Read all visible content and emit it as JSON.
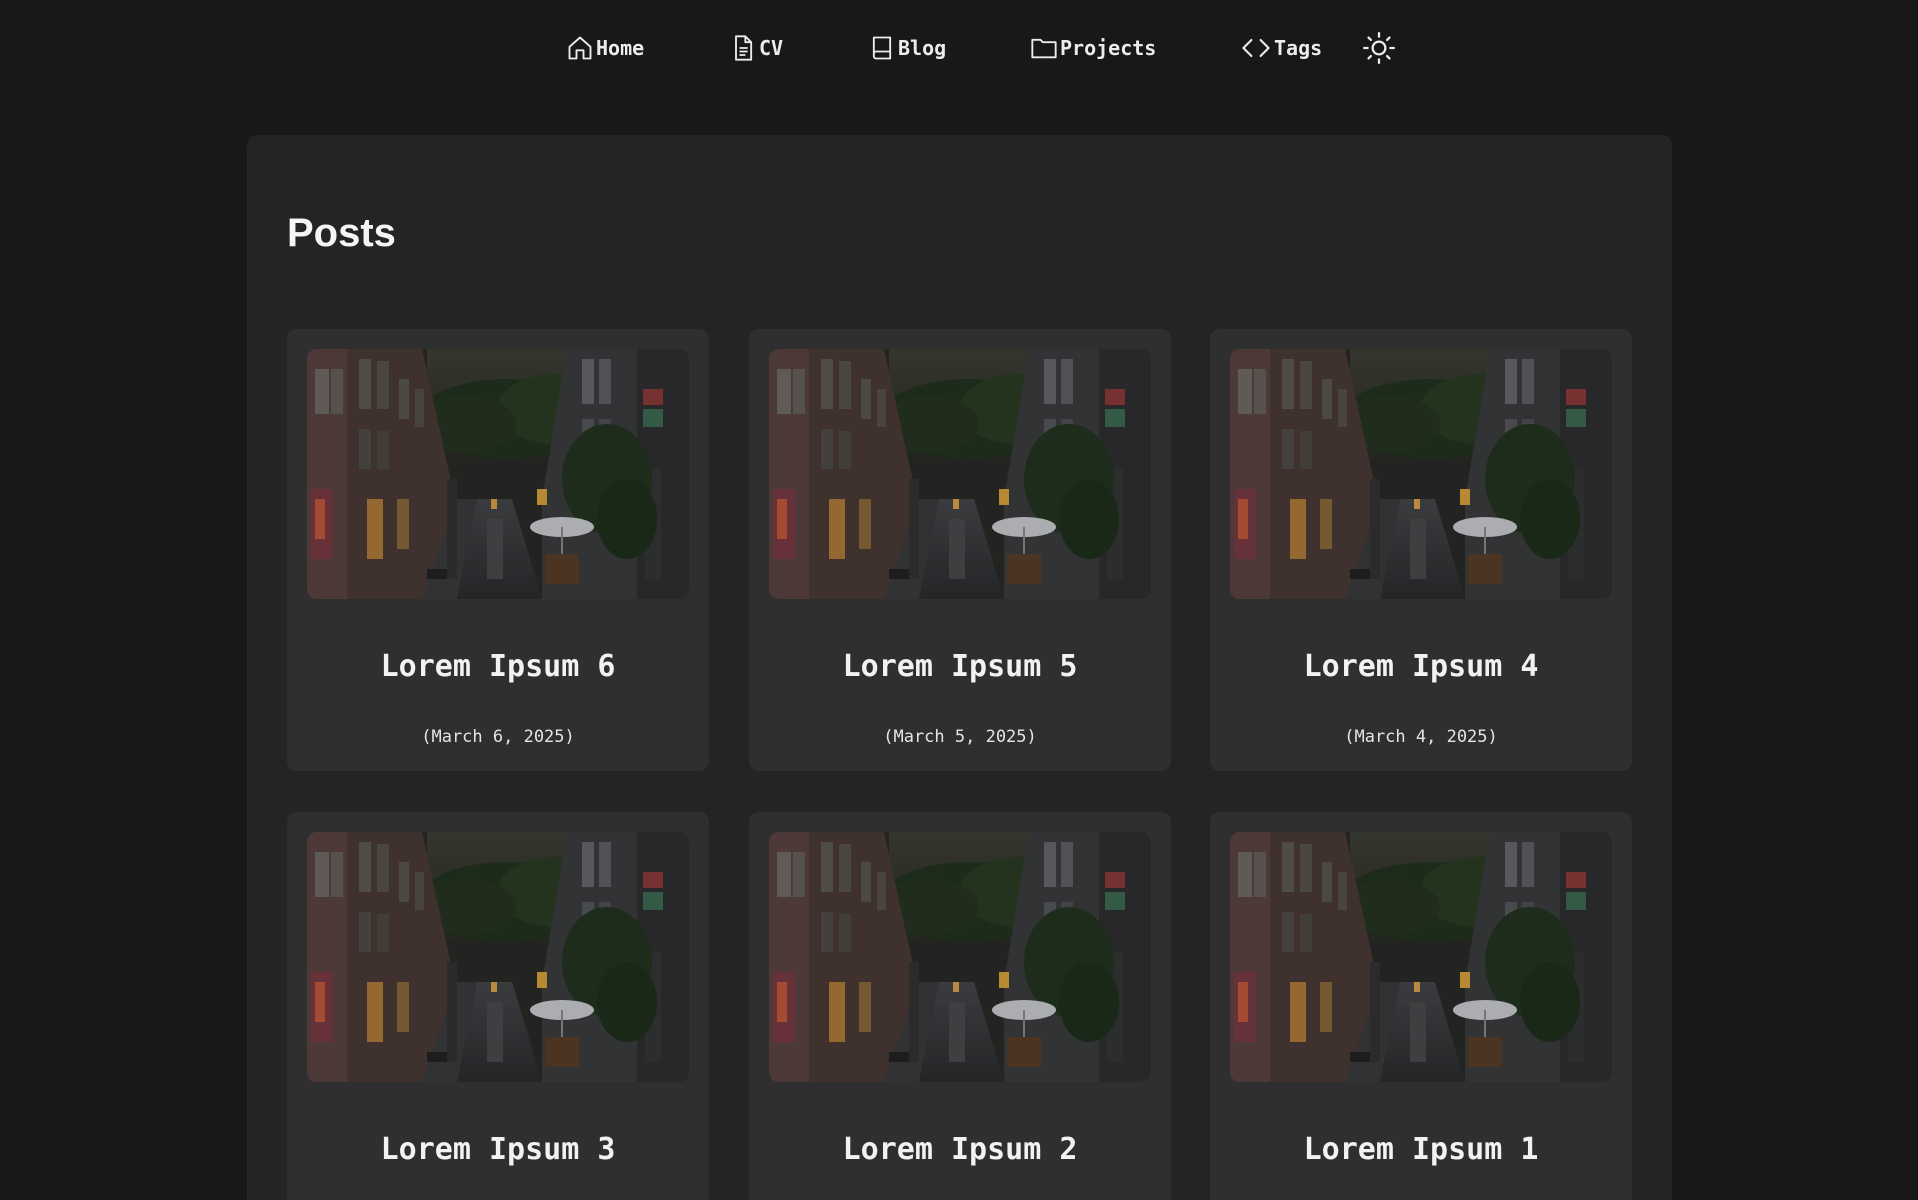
{
  "nav": {
    "items": [
      {
        "label": "Home",
        "icon": "home-icon"
      },
      {
        "label": "CV",
        "icon": "document-icon"
      },
      {
        "label": "Blog",
        "icon": "book-icon"
      },
      {
        "label": "Projects",
        "icon": "folder-icon"
      },
      {
        "label": "Tags",
        "icon": "code-icon"
      }
    ],
    "theme_toggle_icon": "sun-icon"
  },
  "main": {
    "title": "Posts",
    "posts": [
      {
        "title": "Lorem Ipsum 6",
        "date": "(March 6, 2025)"
      },
      {
        "title": "Lorem Ipsum 5",
        "date": "(March 5, 2025)"
      },
      {
        "title": "Lorem Ipsum 4",
        "date": "(March 4, 2025)"
      },
      {
        "title": "Lorem Ipsum 3",
        "date": ""
      },
      {
        "title": "Lorem Ipsum 2",
        "date": ""
      },
      {
        "title": "Lorem Ipsum 1",
        "date": ""
      }
    ]
  },
  "colors": {
    "page_background": "#181818",
    "panel_background": "#242424",
    "card_background": "#2f2f2f",
    "text": "#f2f2f2"
  }
}
